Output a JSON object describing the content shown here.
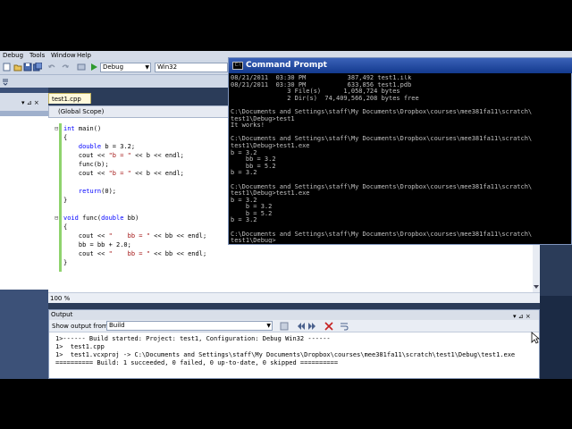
{
  "menu": [
    "Debug",
    "Tools",
    "Window",
    "Help"
  ],
  "toolbar": {
    "config_value": "Debug",
    "platform_value": "Win32"
  },
  "editor": {
    "tab": "test1.cpp",
    "scope": "(Global Scope)",
    "zoom": "100 %",
    "code": [
      {
        "gutter": "⊟",
        "text": "int main()"
      },
      {
        "gutter": "",
        "text": "{"
      },
      {
        "gutter": "",
        "text": "    double b = 3.2;"
      },
      {
        "gutter": "",
        "text": "    cout << \"b = \" << b << endl;"
      },
      {
        "gutter": "",
        "text": "    func(b);"
      },
      {
        "gutter": "",
        "text": "    cout << \"b = \" << b << endl;"
      },
      {
        "gutter": "",
        "text": ""
      },
      {
        "gutter": "",
        "text": "    return(0);"
      },
      {
        "gutter": "",
        "text": "}"
      },
      {
        "gutter": "",
        "text": ""
      },
      {
        "gutter": "⊟",
        "text": "void func(double bb)"
      },
      {
        "gutter": "",
        "text": "{"
      },
      {
        "gutter": "",
        "text": "    cout << \"    bb = \" << bb << endl;"
      },
      {
        "gutter": "",
        "text": "    bb = bb + 2.0;"
      },
      {
        "gutter": "",
        "text": "    cout << \"    bb = \" << bb << endl;"
      },
      {
        "gutter": "",
        "text": "}"
      }
    ]
  },
  "output": {
    "title": "Output",
    "show_label": "Show output from:",
    "source": "Build",
    "lines": [
      "1>------ Build started: Project: test1, Configuration: Debug Win32 ------",
      "1>  test1.cpp",
      "1>  test1.vcxproj -> C:\\Documents and Settings\\staff\\My Documents\\Dropbox\\courses\\mee381fa11\\scratch\\test1\\Debug\\test1.exe",
      "========== Build: 1 succeeded, 0 failed, 0 up-to-date, 0 skipped =========="
    ]
  },
  "cmd": {
    "title": "Command Prompt",
    "lines": [
      "08/21/2011  03:30 PM           387,492 test1.ilk",
      "08/21/2011  03:30 PM           633,856 test1.pdb",
      "               3 File(s)      1,058,724 bytes",
      "               2 Dir(s)  74,409,566,208 bytes free",
      "",
      "C:\\Documents and Settings\\staff\\My Documents\\Dropbox\\courses\\mee381fa11\\scratch\\",
      "test1\\Debug>test1",
      "It works!",
      "",
      "C:\\Documents and Settings\\staff\\My Documents\\Dropbox\\courses\\mee381fa11\\scratch\\",
      "test1\\Debug>test1.exe",
      "b = 3.2",
      "    bb = 3.2",
      "    bb = 5.2",
      "b = 3.2",
      "",
      "C:\\Documents and Settings\\staff\\My Documents\\Dropbox\\courses\\mee381fa11\\scratch\\",
      "test1\\Debug>test1.exe",
      "b = 3.2",
      "    b = 3.2",
      "    b = 5.2",
      "b = 3.2",
      "",
      "C:\\Documents and Settings\\staff\\My Documents\\Dropbox\\courses\\mee381fa11\\scratch\\",
      "test1\\Debug>"
    ]
  }
}
